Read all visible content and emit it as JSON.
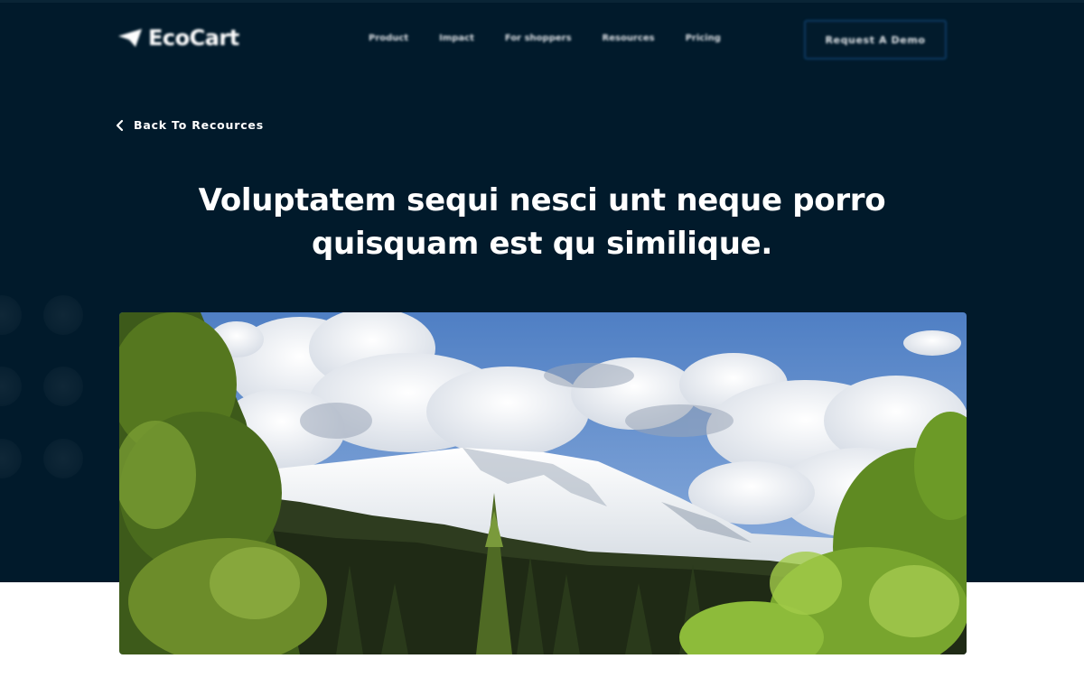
{
  "header": {
    "logo_text": "EcoCart",
    "logo_icon": "paper-plane-icon",
    "nav": [
      "Product",
      "Impact",
      "For shoppers",
      "Resources",
      "Pricing"
    ],
    "cta_label": "Request A Demo"
  },
  "back_link": {
    "label": "Back To Recources",
    "icon": "chevron-left-icon"
  },
  "article": {
    "title_line1": "Voluptatem sequi nesci unt neque porro",
    "title_line2": "quisquam est qu similique."
  },
  "colors": {
    "hero_background": "#011a2b",
    "page_background": "#ffffff",
    "text": "#ffffff",
    "cta_border": "#0d3a63"
  }
}
